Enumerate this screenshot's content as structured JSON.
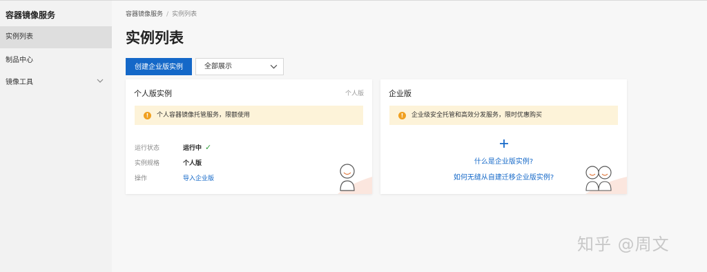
{
  "sidebar": {
    "title": "容器镜像服务",
    "items": [
      {
        "label": "实例列表",
        "active": true
      },
      {
        "label": "制品中心"
      },
      {
        "label": "镜像工具",
        "expandable": true
      }
    ]
  },
  "breadcrumb": {
    "root": "容器镜像服务",
    "separator": "/",
    "current": "实例列表"
  },
  "page": {
    "title": "实例列表"
  },
  "toolbar": {
    "create_label": "创建企业版实例",
    "filter_value": "全部展示"
  },
  "cards": {
    "personal": {
      "title": "个人版实例",
      "tag": "个人版",
      "notice": "个人容器镜像托管服务，限额使用",
      "rows": {
        "status_key": "运行状态",
        "status_value": "运行中",
        "spec_key": "实例规格",
        "spec_value": "个人版",
        "action_key": "操作",
        "action_value": "导入企业版"
      }
    },
    "enterprise": {
      "title": "企业版",
      "notice": "企业级安全托管和高效分发服务，限时优惠购买",
      "link1": "什么是企业版实例?",
      "link2": "如何无缝从自建迁移企业版实例?"
    }
  },
  "watermark": "知乎 @周文",
  "colors": {
    "primary": "#1468c8",
    "notice_bg": "#fdf3d9",
    "warn": "#f0a020",
    "success": "#2e9c3a",
    "deco": "#fbe6de"
  },
  "icons": [
    "warning-icon",
    "check-icon",
    "plus-icon",
    "chevron-down-icon",
    "chevron-left-icon",
    "person-avatar-icon",
    "two-person-avatar-icon"
  ]
}
